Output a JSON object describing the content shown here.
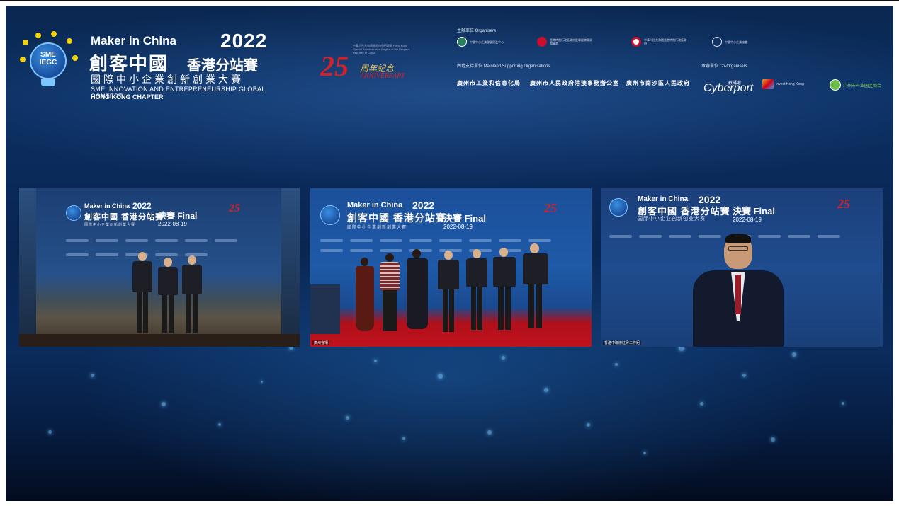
{
  "header": {
    "logo_badge_line1": "SME",
    "logo_badge_line2": "IEGC",
    "maker_in_china": "Maker in China",
    "year": "2022",
    "title_cn": "創客中國",
    "chapter_cn": "香港分站賽",
    "subtitle_cn": "國際中小企業創新創業大賽",
    "subtitle_en": "SME INNOVATION AND ENTREPRENEURSHIP GLOBAL CONTEST",
    "chapter_en": "HONG KONG CHAPTER"
  },
  "anniversary": {
    "number": "25",
    "cn": "周年紀念",
    "en": "ANNIVERSARY",
    "tiny": "中華人民共和國香港特別行政區 Hong Kong Special Administrative Region of the People's Republic of China"
  },
  "organisers": {
    "label": "主辦單位  Organisers",
    "items": [
      "中國中小企業發展促進中心",
      "香港特別行政區政府駐粵經濟貿易辦事處",
      "中華人民共和國香港特別行政區政府",
      "中國中小企業協會"
    ],
    "mainland_label": "內地支持單位  Mainland Supporting Organisations",
    "mainland_items": [
      "廣州市工業和信息化局",
      "廣州市人民政府港澳事務辦公室",
      "廣州市南沙區人民政府"
    ],
    "coorg_label": "承辦單位  Co-Organisers",
    "cyberport": "Cyberport",
    "cyberport_cn": "數碼港",
    "coorg_items": [
      "Invest Hong Kong",
      "广州市产业园区商会"
    ]
  },
  "panels": [
    {
      "maker": "Maker in China",
      "year": "2022",
      "title_cn": "創客中國 香港分站賽",
      "final": "決賽 Final",
      "date": "2022-08-19",
      "sub": "國際中小企業創新創業大賽",
      "anniv": "25",
      "caption": ""
    },
    {
      "maker": "Maker in China",
      "year": "2022",
      "title_cn": "創客中國 香港分站賽",
      "final": "決賽 Final",
      "date": "2022-08-19",
      "sub": "國際中小企業創新創業大賽",
      "anniv": "25",
      "caption": "廣州會場"
    },
    {
      "maker": "Maker in China",
      "year": "2022",
      "title_cn": "創客中國 香港分站賽",
      "final": "決賽 Final",
      "date": "2022-08-19",
      "sub": "国际中小企业创新创业大赛",
      "anniv": "25",
      "caption": "香港中聯辦駐粵工作組"
    }
  ],
  "colors": {
    "accent_red": "#d4202a",
    "accent_yellow": "#f5d20a",
    "background": "#0a2a5a"
  }
}
